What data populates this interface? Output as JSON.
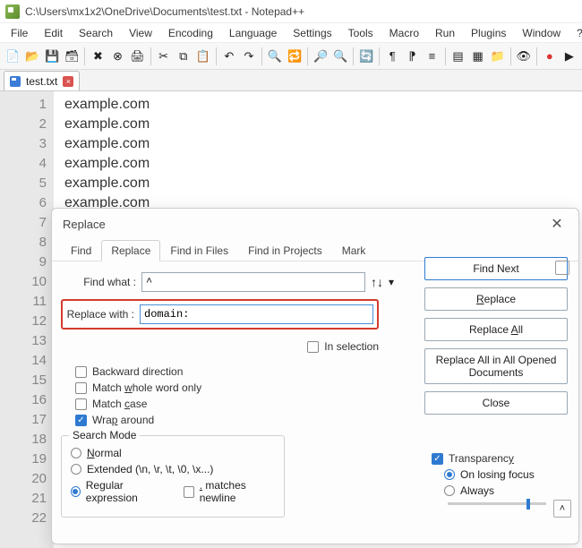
{
  "titlebar": {
    "path": "C:\\Users\\mx1x2\\OneDrive\\Documents\\test.txt - Notepad++"
  },
  "menu": [
    "File",
    "Edit",
    "Search",
    "View",
    "Encoding",
    "Language",
    "Settings",
    "Tools",
    "Macro",
    "Run",
    "Plugins",
    "Window",
    "?"
  ],
  "filetab": {
    "name": "test.txt"
  },
  "lines": [
    "example.com",
    "example.com",
    "example.com",
    "example.com",
    "example.com",
    "example.com"
  ],
  "gutter_max": 22,
  "dlg": {
    "title": "Replace",
    "tabs": [
      "Find",
      "Replace",
      "Find in Files",
      "Find in Projects",
      "Mark"
    ],
    "active_tab": 1,
    "find_label": "Find what :",
    "find_value": "^",
    "replace_label": "Replace with :",
    "replace_value": "domain:",
    "in_selection": "In selection",
    "backward": "Backward direction",
    "whole_word": "Match whole word only",
    "match_case": "Match case",
    "wrap": "Wrap around",
    "search_mode": {
      "legend": "Search Mode",
      "normal": "Normal",
      "extended": "Extended (\\n, \\r, \\t, \\0, \\x...)",
      "regex": "Regular expression",
      "matches_newline": ". matches newline"
    },
    "buttons": {
      "find_next": "Find Next",
      "replace": "Replace",
      "replace_all": "Replace All",
      "replace_all_opened": "Replace All in All Opened Documents",
      "close": "Close"
    },
    "transparency": {
      "label": "Transparency",
      "losing": "On losing focus",
      "always": "Always"
    }
  }
}
